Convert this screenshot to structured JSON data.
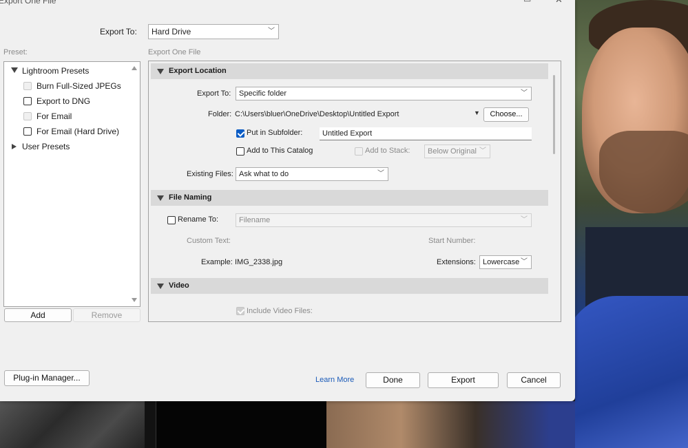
{
  "window": {
    "title": "Export One File",
    "minimize_icon": "minimize-icon",
    "close_icon": "close-icon"
  },
  "header": {
    "export_to_label": "Export To:",
    "export_to_value": "Hard Drive"
  },
  "preset": {
    "label": "Preset:",
    "groups": [
      {
        "label": "Lightroom Presets",
        "expanded": true
      },
      {
        "label": "User Presets",
        "expanded": false
      }
    ],
    "items": [
      {
        "label": "Burn Full-Sized JPEGs"
      },
      {
        "label": "Export to DNG"
      },
      {
        "label": "For Email"
      },
      {
        "label": "For Email (Hard Drive)"
      }
    ],
    "add_label": "Add",
    "remove_label": "Remove"
  },
  "settings": {
    "heading": "Export One File",
    "export_location": {
      "title": "Export Location",
      "export_to_label": "Export To:",
      "export_to_value": "Specific folder",
      "folder_label": "Folder:",
      "folder_path": "C:\\Users\\bluer\\OneDrive\\Desktop\\Untitled Export",
      "choose_label": "Choose...",
      "subfolder_label": "Put in Subfolder:",
      "subfolder_checked": true,
      "subfolder_value": "Untitled Export",
      "add_catalog_label": "Add to This Catalog",
      "add_stack_label": "Add to Stack:",
      "stack_value": "Below Original",
      "existing_files_label": "Existing Files:",
      "existing_files_value": "Ask what to do"
    },
    "file_naming": {
      "title": "File Naming",
      "rename_label": "Rename To:",
      "rename_value": "Filename",
      "custom_text_label": "Custom Text:",
      "start_number_label": "Start Number:",
      "example_label": "Example:",
      "example_value": "IMG_2338.jpg",
      "extensions_label": "Extensions:",
      "extensions_value": "Lowercase"
    },
    "video": {
      "title": "Video",
      "include_label": "Include Video Files:"
    }
  },
  "footer": {
    "plugin_manager_label": "Plug-in Manager...",
    "learn_more_label": "Learn More",
    "done_label": "Done",
    "export_label": "Export",
    "cancel_label": "Cancel"
  },
  "colors": {
    "accent": "#0a5cc5",
    "link": "#1a5ab8",
    "section_header": "#d9d9d9"
  }
}
